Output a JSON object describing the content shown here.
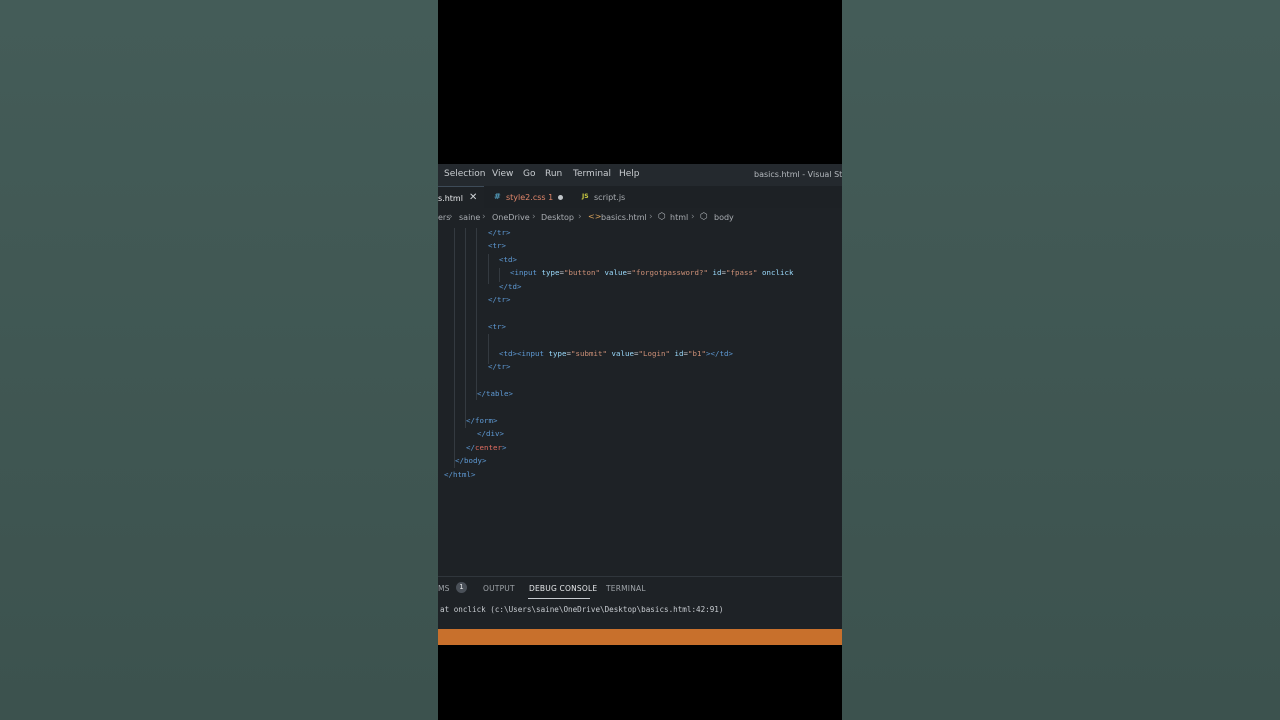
{
  "menu": {
    "items": [
      "Selection",
      "View",
      "Go",
      "Run",
      "Terminal",
      "Help"
    ],
    "window_title": "basics.html - Visual Studio"
  },
  "tabs": [
    {
      "label": "s.html",
      "icon": "close-icon",
      "active": true
    },
    {
      "icon_text": "#",
      "label": "style2.css 1",
      "modified": true
    },
    {
      "icon_text": "JS",
      "label": "script.js"
    }
  ],
  "breadcrumb": {
    "parts": [
      "ers",
      "saine",
      "OneDrive",
      "Desktop",
      "basics.html",
      "html",
      "body"
    ],
    "html_icon": "<>"
  },
  "code": {
    "l1": "</tr>",
    "l2": "<tr>",
    "l3": "<td>",
    "l4a": "<input",
    "l4b": "type",
    "l4c": "\"button\"",
    "l4d": "value",
    "l4e": "\"forgotpassword?\"",
    "l4f": "id",
    "l4g": "\"fpass\"",
    "l4h": "onclick",
    "l5": "</td>",
    "l6": "</tr>",
    "l7": "<tr>",
    "l8a": "<td><input",
    "l8b": "type",
    "l8c": "\"submit\"",
    "l8d": "value",
    "l8e": "\"Login\"",
    "l8f": "id",
    "l8g": "\"b1\"",
    "l8h": "></td>",
    "l9": "</tr>",
    "l10": "</table>",
    "l11": "</form>",
    "l12": "</div>",
    "l13a": "</",
    "l13b": "center",
    "l13c": ">",
    "l14": "</body>",
    "l15": "</html>"
  },
  "panel": {
    "tabs": [
      "MS",
      "OUTPUT",
      "DEBUG CONSOLE",
      "TERMINAL"
    ],
    "badge": "1",
    "console_line": "at onclick (c:\\Users\\saine\\OneDrive\\Desktop\\basics.html:42:91)"
  },
  "colors": {
    "status_bar": "#c8702c",
    "editor_bg": "#1e2226",
    "tag": "#5f9bd6",
    "attribute": "#9cdcfe",
    "string": "#ce9178"
  }
}
